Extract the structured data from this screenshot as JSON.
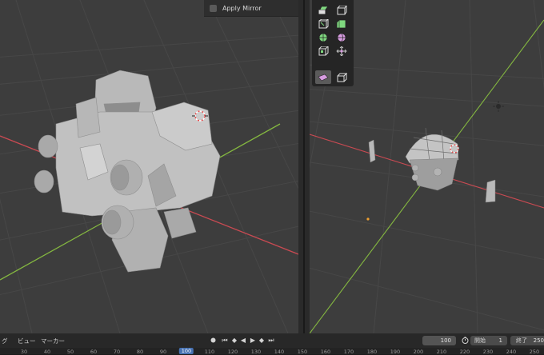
{
  "viewport_left": {
    "overlay_panel": {
      "apply_mirror_label": "Apply Mirror",
      "apply_mirror_checked": false
    }
  },
  "viewport_right": {
    "tools": [
      "extrude-region-icon",
      "extrude-individual-icon",
      "inset-faces-icon",
      "bevel-icon",
      "loop-cut-icon",
      "knife-icon",
      "poly-build-icon",
      "spin-icon",
      "smooth-vertex-icon",
      "randomize-icon",
      "edge-slide-icon",
      "shrink-fatten-icon"
    ],
    "active_tool_index": 10
  },
  "timeline": {
    "menu": {
      "view_partial": "グ",
      "view": "ビュー",
      "marker": "マーカー"
    },
    "current_frame": "100",
    "start_label": "開始",
    "start_value": "1",
    "end_label": "終了",
    "end_value": "250",
    "ruler_ticks": [
      "30",
      "40",
      "50",
      "60",
      "70",
      "80",
      "90",
      "100",
      "110",
      "120",
      "130",
      "140",
      "150",
      "160",
      "170",
      "180",
      "190",
      "200",
      "210",
      "220",
      "230",
      "240",
      "250"
    ],
    "active_tick": "100"
  },
  "colors": {
    "viewport_bg": "#3d3d3d",
    "x_axis": "#c94a52",
    "y_axis": "#84b740",
    "accent": "#4772b3",
    "header_bg": "#282828"
  }
}
